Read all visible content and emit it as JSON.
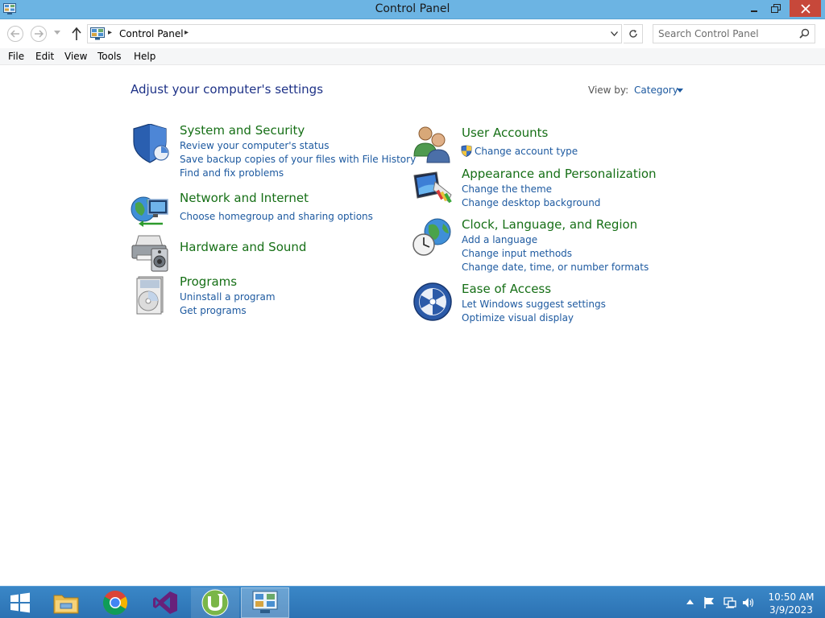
{
  "window": {
    "title": "Control Panel"
  },
  "address_bar": {
    "breadcrumb": "Control Panel",
    "search_placeholder": "Search Control Panel"
  },
  "menu": [
    "File",
    "Edit",
    "View",
    "Tools",
    "Help"
  ],
  "content": {
    "heading": "Adjust your computer's settings",
    "view_by_label": "View by:",
    "view_by_value": "Category"
  },
  "categories": [
    {
      "title": "System and Security",
      "icon": "shield-icon",
      "links": [
        "Review your computer's status",
        "Save backup copies of your files with File History",
        "Find and fix problems"
      ]
    },
    {
      "title": "Network and Internet",
      "icon": "network-globe-icon",
      "links": [
        "Choose homegroup and sharing options"
      ]
    },
    {
      "title": "Hardware and Sound",
      "icon": "printer-speaker-icon",
      "links": []
    },
    {
      "title": "Programs",
      "icon": "programs-disc-icon",
      "links": [
        "Uninstall a program",
        "Get programs"
      ]
    },
    {
      "title": "User Accounts",
      "icon": "users-icon",
      "links": [
        "Change account type"
      ]
    },
    {
      "title": "Appearance and Personalization",
      "icon": "monitor-palette-icon",
      "links": [
        "Change the theme",
        "Change desktop background"
      ]
    },
    {
      "title": "Clock, Language, and Region",
      "icon": "clock-globe-icon",
      "links": [
        "Add a language",
        "Change input methods",
        "Change date, time, or number formats"
      ]
    },
    {
      "title": "Ease of Access",
      "icon": "ease-of-access-icon",
      "links": [
        "Let Windows suggest settings",
        "Optimize visual display"
      ]
    }
  ],
  "taskbar": {
    "items": [
      "start-icon",
      "file-explorer-icon",
      "chrome-icon",
      "visual-studio-icon",
      "utorrent-icon",
      "control-panel-icon"
    ],
    "tray_icons": [
      "show-hidden-icons-icon",
      "action-center-flag-icon",
      "network-icon",
      "volume-icon"
    ],
    "time": "10:50 AM",
    "date": "3/9/2023"
  },
  "colors": {
    "titlebar": "#6cb4e3",
    "close_button": "#c7483a",
    "category_title": "#166f16",
    "link": "#1e5aa0",
    "heading": "#1e3287",
    "taskbar": "#2c72b3"
  }
}
